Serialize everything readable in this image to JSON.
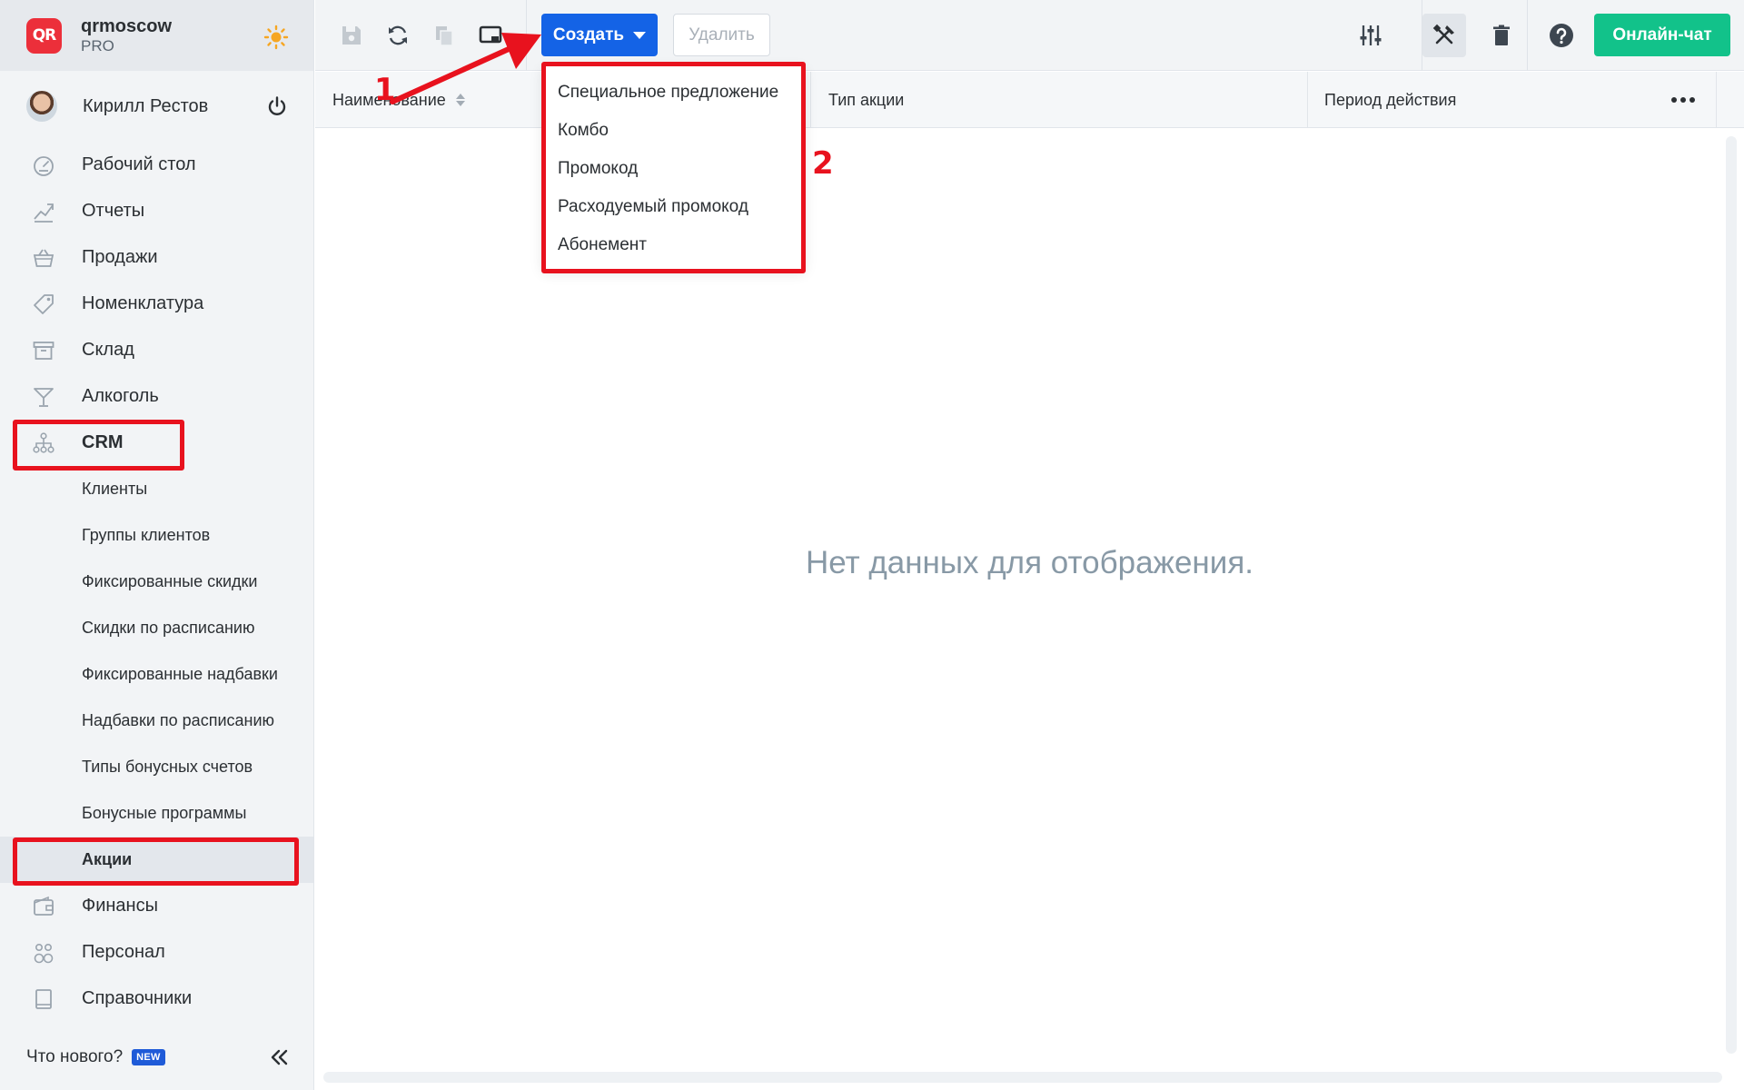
{
  "brand": {
    "logo_text": "QR",
    "name": "qrmoscow",
    "plan": "PRO"
  },
  "user": {
    "name": "Кирилл Рестов"
  },
  "nav": {
    "items": [
      {
        "label": "Рабочий стол",
        "icon": "dashboard-icon"
      },
      {
        "label": "Отчеты",
        "icon": "chart-icon"
      },
      {
        "label": "Продажи",
        "icon": "basket-icon"
      },
      {
        "label": "Номенклатура",
        "icon": "tag-icon"
      },
      {
        "label": "Склад",
        "icon": "archive-icon"
      },
      {
        "label": "Алкоголь",
        "icon": "cocktail-icon"
      },
      {
        "label": "CRM",
        "icon": "org-chart-icon"
      }
    ],
    "crm_sub": [
      "Клиенты",
      "Группы клиентов",
      "Фиксированные скидки",
      "Скидки по расписанию",
      "Фиксированные надбавки",
      "Надбавки по расписанию",
      "Типы бонусных счетов",
      "Бонусные программы",
      "Акции"
    ],
    "items_after": [
      {
        "label": "Финансы",
        "icon": "wallet-icon"
      },
      {
        "label": "Персонал",
        "icon": "people-icon"
      },
      {
        "label": "Справочники",
        "icon": "book-icon"
      }
    ]
  },
  "footer": {
    "whats_new": "Что нового?",
    "badge": "NEW"
  },
  "toolbar": {
    "create_label": "Создать",
    "delete_label": "Удалить",
    "chat_label": "Онлайн-чат"
  },
  "dropdown": {
    "items": [
      "Специальное предложение",
      "Комбо",
      "Промокод",
      "Расходуемый промокод",
      "Абонемент"
    ]
  },
  "table": {
    "columns": [
      "Наименование",
      "Тип акции",
      "Период действия"
    ],
    "empty_text": "Нет данных для отображения."
  },
  "annotations": {
    "one": "1",
    "two": "2"
  },
  "colors": {
    "accent_blue": "#1463e6",
    "chat_green": "#12c28a",
    "highlight_red": "#e8121e",
    "logo_red": "#ec2f3a"
  }
}
